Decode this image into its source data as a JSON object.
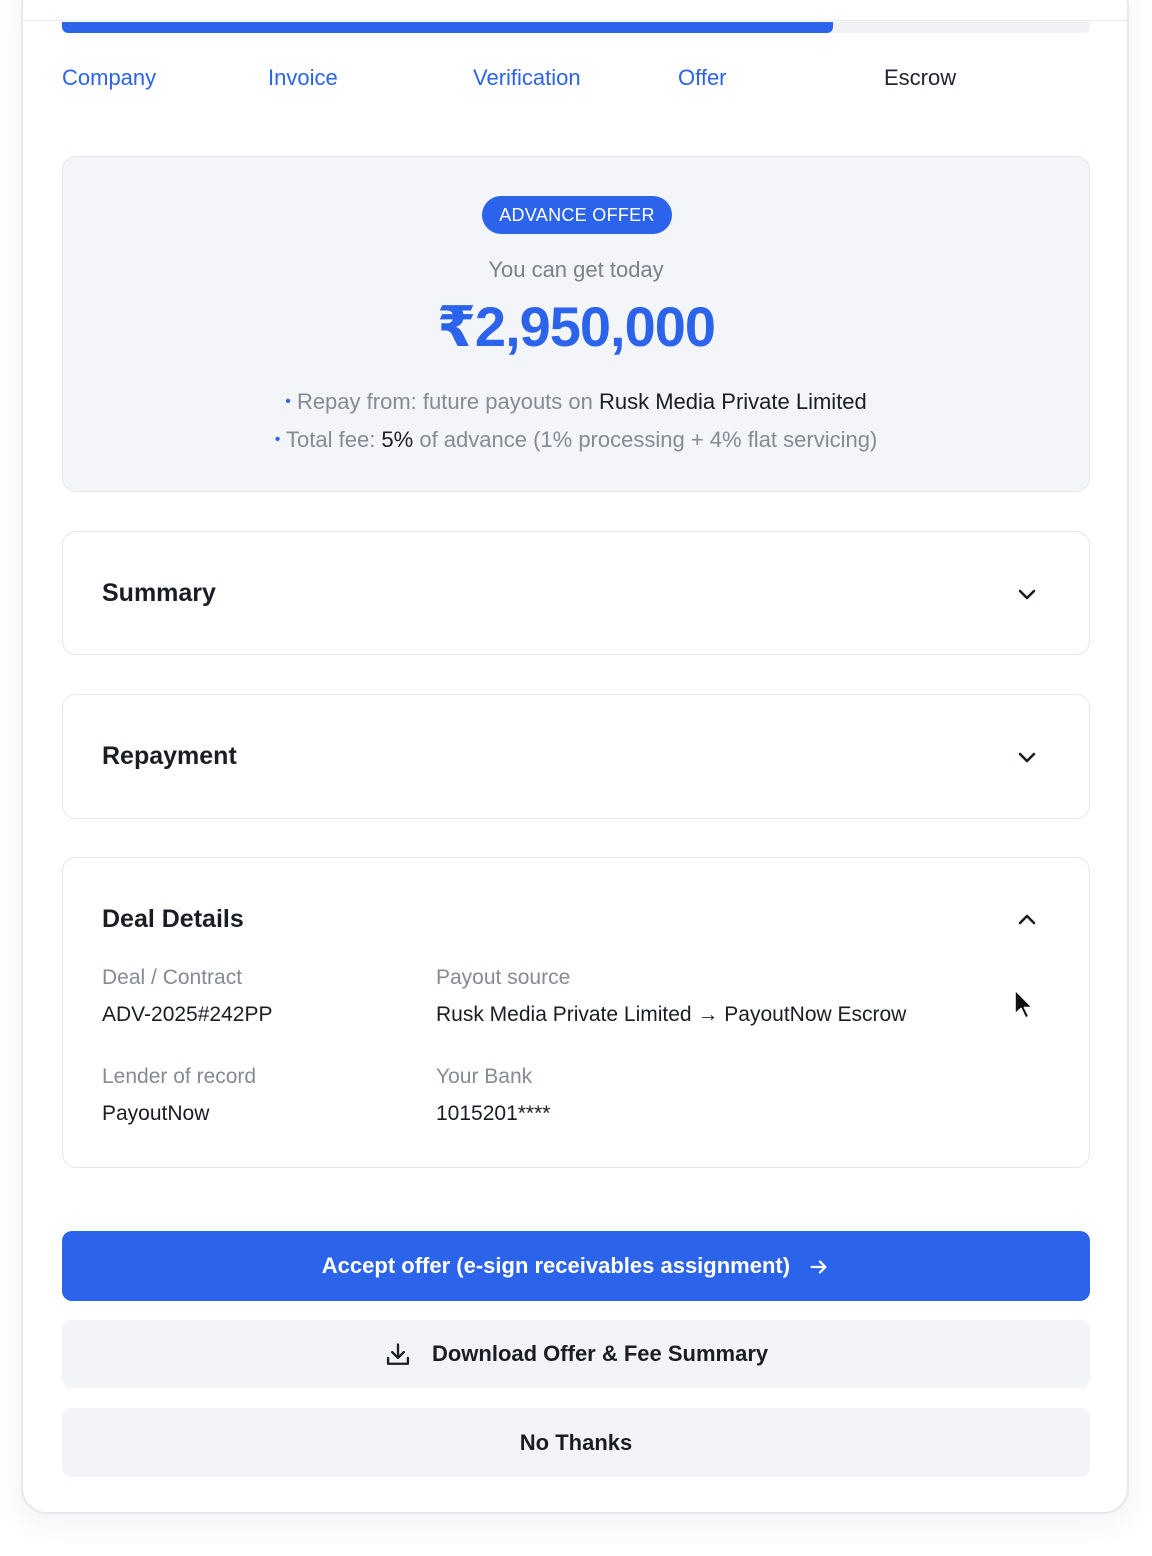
{
  "progress": {
    "percent": 75
  },
  "steps": [
    {
      "label": "Company",
      "state": "done"
    },
    {
      "label": "Invoice",
      "state": "done"
    },
    {
      "label": "Verification",
      "state": "done"
    },
    {
      "label": "Offer",
      "state": "done"
    },
    {
      "label": "Escrow",
      "state": "current"
    }
  ],
  "offer": {
    "badge": "ADVANCE OFFER",
    "subtitle": "You can get today",
    "amount": "₹2,950,000",
    "bullet_glyph": "•",
    "repay_prefix": "Repay from: future payouts on ",
    "repay_company": "Rusk Media Private Limited",
    "fee_prefix": "Total fee: ",
    "fee_percent": "5%",
    "fee_suffix": " of advance (1% processing + 4% flat servicing)"
  },
  "sections": {
    "summary": {
      "title": "Summary",
      "icon": "chevron-down-icon"
    },
    "repayment": {
      "title": "Repayment",
      "icon": "chevron-down-icon"
    },
    "deal_details": {
      "title": "Deal Details",
      "icon": "chevron-up-icon",
      "deal_label": "Deal / Contract",
      "deal_value": "ADV-2025#242PP",
      "payout_label": "Payout source",
      "payout_value": "Rusk Media Private Limited → PayoutNow Escrow",
      "lender_label": "Lender of record",
      "lender_value": "PayoutNow",
      "bank_label": "Your Bank",
      "bank_value": "1015201****"
    }
  },
  "actions": {
    "accept_label": "Accept offer (e-sign receivables assignment)",
    "accept_icon": "arrow-right-icon",
    "download_label": "Download Offer & Fee Summary",
    "download_icon": "download-icon",
    "decline_label": "No Thanks"
  },
  "colors": {
    "accent": "#2b63ea",
    "muted_text": "#858a94",
    "panel_bg": "#f3f5f8"
  }
}
